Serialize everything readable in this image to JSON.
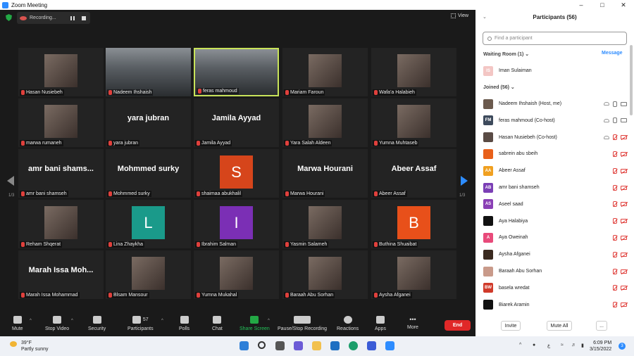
{
  "window": {
    "title": "Zoom Meeting"
  },
  "recording": {
    "label": "Recording..."
  },
  "view": {
    "label": "View"
  },
  "gallery": {
    "page_indicator": "1/3",
    "tiles": [
      {
        "name": "Hasan Nusiebeh",
        "display": "photo"
      },
      {
        "name": "Nadeem Ihshaish",
        "display": "video"
      },
      {
        "name": "feras mahmoud",
        "display": "video",
        "active": true
      },
      {
        "name": "Mariam Faroun",
        "display": "photo"
      },
      {
        "name": "Wafa'a Halabieh",
        "display": "photo"
      },
      {
        "name": "marwa rumaneh",
        "display": "photo"
      },
      {
        "name": "yara jubran",
        "display": "text",
        "big": "yara jubran"
      },
      {
        "name": "Jamila Ayyad",
        "display": "text",
        "big": "Jamila Ayyad"
      },
      {
        "name": "Yara Salah  Aldeen",
        "display": "photo"
      },
      {
        "name": "Yumna Muhtaseb",
        "display": "photo"
      },
      {
        "name": "amr bani shamseh",
        "display": "text",
        "big": "amr bani shams..."
      },
      {
        "name": "Mohmmed surky",
        "display": "text",
        "big": "Mohmmed surky"
      },
      {
        "name": "shaimaa abukhalil",
        "display": "letter",
        "letter": "S",
        "color": "#d6451b"
      },
      {
        "name": "Marwa Hourani",
        "display": "text",
        "big": "Marwa Hourani"
      },
      {
        "name": "Abeer Assaf",
        "display": "text",
        "big": "Abeer Assaf"
      },
      {
        "name": "Reham Shqerat",
        "display": "photo"
      },
      {
        "name": "Lina Zhaykha",
        "display": "letter",
        "letter": "L",
        "color": "#1a9a8a"
      },
      {
        "name": "Ibrahim Salman",
        "display": "letter",
        "letter": "I",
        "color": "#7b2fb5"
      },
      {
        "name": "Yasmin Salameh",
        "display": "photo"
      },
      {
        "name": "Buthina Shuaibat",
        "display": "letter",
        "letter": "B",
        "color": "#e8501a"
      },
      {
        "name": "Marah Issa Mohammad",
        "display": "text",
        "big": "Marah Issa Moh..."
      },
      {
        "name": "Blsam Mansour",
        "display": "photo"
      },
      {
        "name": "Yumna Mukahal",
        "display": "photo"
      },
      {
        "name": "Baraah Abu Sorhan",
        "display": "photo"
      },
      {
        "name": "Aysha Afganei",
        "display": "photo"
      }
    ]
  },
  "toolbar": {
    "mute": "Mute",
    "stop_video": "Stop Video",
    "security": "Security",
    "participants": "Participants",
    "participants_count": "57",
    "polls": "Polls",
    "chat": "Chat",
    "share_screen": "Share Screen",
    "recording": "Pause/Stop Recording",
    "reactions": "Reactions",
    "apps": "Apps",
    "more": "More",
    "end": "End"
  },
  "panel": {
    "title": "Participants (56)",
    "search_placeholder": "Find a participant",
    "waiting_room": "Waiting Room (1)",
    "message": "Message",
    "waiting": [
      {
        "initials": "IS",
        "name": "Iman Sulaiman",
        "color": "#f3c6c4"
      }
    ],
    "joined": "Joined (56)",
    "participants": [
      {
        "initials": "",
        "name": "Nadeem Ihshaish (Host, me)",
        "color": "#6b5a4e",
        "state": "on"
      },
      {
        "initials": "FM",
        "name": "feras mahmoud (Co-host)",
        "color": "#3d4a5c",
        "state": "on"
      },
      {
        "initials": "",
        "name": "Hasan Nusiebeh (Co-host)",
        "color": "#5a4b45",
        "state": "off"
      },
      {
        "initials": "",
        "name": "sabrein abu sbeih",
        "color": "#e8601a",
        "state": "off"
      },
      {
        "initials": "AA",
        "name": "Abeer Assaf",
        "color": "#f0a020",
        "state": "off"
      },
      {
        "initials": "AB",
        "name": "amr bani shamseh",
        "color": "#7b3fb5",
        "state": "off"
      },
      {
        "initials": "AS",
        "name": "Aseel saad",
        "color": "#8a3fb5",
        "state": "off"
      },
      {
        "initials": "",
        "name": "Aya Halabiya",
        "color": "#111111",
        "state": "off"
      },
      {
        "initials": "A",
        "name": "Aya Oweinah",
        "color": "#e84a7a",
        "state": "off"
      },
      {
        "initials": "",
        "name": "Aysha Afganei",
        "color": "#3a2a20",
        "state": "off"
      },
      {
        "initials": "",
        "name": "Baraah Abu Sorhan",
        "color": "#c99a8a",
        "state": "off"
      },
      {
        "initials": "BW",
        "name": "basela wredat",
        "color": "#d03a2a",
        "state": "off"
      },
      {
        "initials": "",
        "name": "Biarek Aramin",
        "color": "#111111",
        "state": "off"
      }
    ],
    "invite": "Invite",
    "mute_all": "Mute All",
    "more": "..."
  },
  "taskbar": {
    "weather_temp": "39°F",
    "weather_desc": "Partly sunny",
    "lang": "ع",
    "time": "6:09 PM",
    "date": "3/15/2022",
    "notifications": "3"
  }
}
